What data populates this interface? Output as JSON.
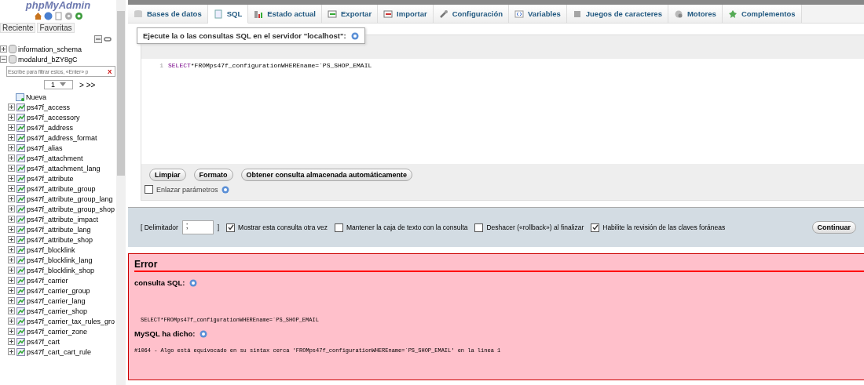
{
  "sidebar": {
    "logo": "phpMyAdmin",
    "nav_tabs": [
      {
        "label": "Reciente"
      },
      {
        "label": "Favoritas"
      }
    ],
    "tree": [
      {
        "label": "information_schema",
        "expanded": false,
        "kind": "database"
      },
      {
        "label": "modalurd_bZY8gC",
        "expanded": true,
        "kind": "database"
      }
    ],
    "filter": {
      "placeholder": "Escribe para filtrar estos, «Enter» p",
      "clear": "X"
    },
    "pager": {
      "page": "1",
      "next": "> >>"
    },
    "tables": [
      {
        "label": "Nueva",
        "kind": "new"
      },
      {
        "label": "ps47f_access",
        "kind": "table"
      },
      {
        "label": "ps47f_accessory",
        "kind": "table"
      },
      {
        "label": "ps47f_address",
        "kind": "table"
      },
      {
        "label": "ps47f_address_format",
        "kind": "table"
      },
      {
        "label": "ps47f_alias",
        "kind": "table"
      },
      {
        "label": "ps47f_attachment",
        "kind": "table"
      },
      {
        "label": "ps47f_attachment_lang",
        "kind": "table"
      },
      {
        "label": "ps47f_attribute",
        "kind": "table"
      },
      {
        "label": "ps47f_attribute_group",
        "kind": "table"
      },
      {
        "label": "ps47f_attribute_group_lang",
        "kind": "table"
      },
      {
        "label": "ps47f_attribute_group_shop",
        "kind": "table"
      },
      {
        "label": "ps47f_attribute_impact",
        "kind": "table"
      },
      {
        "label": "ps47f_attribute_lang",
        "kind": "table"
      },
      {
        "label": "ps47f_attribute_shop",
        "kind": "table"
      },
      {
        "label": "ps47f_blocklink",
        "kind": "table"
      },
      {
        "label": "ps47f_blocklink_lang",
        "kind": "table"
      },
      {
        "label": "ps47f_blocklink_shop",
        "kind": "table"
      },
      {
        "label": "ps47f_carrier",
        "kind": "table"
      },
      {
        "label": "ps47f_carrier_group",
        "kind": "table"
      },
      {
        "label": "ps47f_carrier_lang",
        "kind": "table"
      },
      {
        "label": "ps47f_carrier_shop",
        "kind": "table"
      },
      {
        "label": "ps47f_carrier_tax_rules_gro",
        "kind": "table"
      },
      {
        "label": "ps47f_carrier_zone",
        "kind": "table"
      },
      {
        "label": "ps47f_cart",
        "kind": "table"
      },
      {
        "label": "ps47f_cart_cart_rule",
        "kind": "table"
      }
    ]
  },
  "tabs": [
    {
      "label": "Bases de datos",
      "selected": false
    },
    {
      "label": "SQL",
      "selected": true
    },
    {
      "label": "Estado actual",
      "selected": false
    },
    {
      "label": "Exportar",
      "selected": false
    },
    {
      "label": "Importar",
      "selected": false
    },
    {
      "label": "Configuración",
      "selected": false
    },
    {
      "label": "Variables",
      "selected": false
    },
    {
      "label": "Juegos de caracteres",
      "selected": false
    },
    {
      "label": "Motores",
      "selected": false
    },
    {
      "label": "Complementos",
      "selected": false
    }
  ],
  "sql_box": {
    "legend": "Ejecute la o las consultas SQL en el servidor \"localhost\":",
    "editor": {
      "line_number": "1",
      "keyword": "SELECT",
      "rest": "*FROMps47f_configurationWHEREname=´PS_SHOP_EMAIL"
    },
    "buttons": [
      "Limpiar",
      "Formato",
      "Obtener consulta almacenada automáticamente"
    ],
    "bind_params": {
      "label": "Enlazar parámetros",
      "checked": false
    }
  },
  "options": {
    "delimiter_label": "[ Delimitador",
    "delimiter_value": ";",
    "delimiter_close": "]",
    "checks": [
      {
        "label": "Mostrar esta consulta otra vez",
        "checked": true
      },
      {
        "label": "Mantener la caja de texto con la consulta",
        "checked": false
      },
      {
        "label": "Deshacer («rollback») al finalizar",
        "checked": false
      },
      {
        "label": "Habilite la revisión de las claves foráneas",
        "checked": true
      }
    ],
    "submit": "Continuar"
  },
  "error": {
    "title": "Error",
    "query_label": "consulta SQL:",
    "query": "SELECT*FROMps47f_configurationWHEREname=´PS_SHOP_EMAIL",
    "said_label": "MySQL ha dicho:",
    "message": "#1064 - Algo está equivocado en su sintax cerca 'FROMps47f_configurationWHEREname=´PS_SHOP_EMAIL' en la linea 1"
  }
}
